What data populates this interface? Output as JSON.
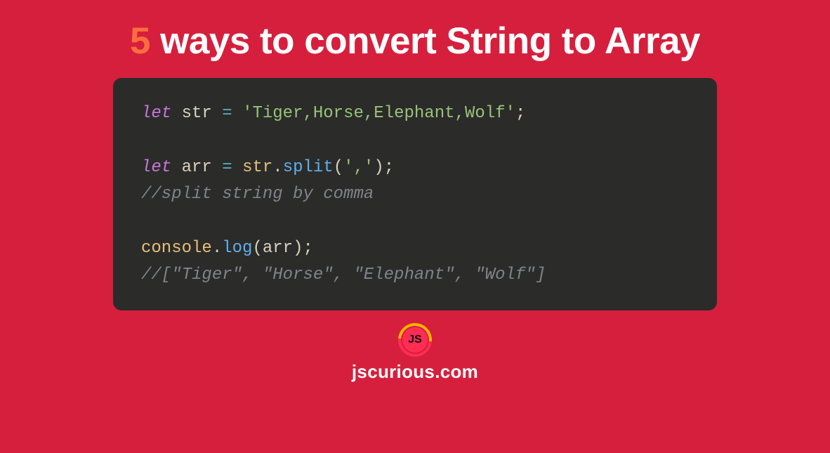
{
  "title": {
    "accent": "5",
    "rest": " ways to convert String to Array"
  },
  "code": {
    "line1": {
      "keyword": "let",
      "var": "str",
      "op": "=",
      "string": "'Tiger,Horse,Elephant,Wolf'",
      "semicolon": ";"
    },
    "line2": {
      "keyword": "let",
      "var": "arr",
      "op": "=",
      "obj": "str",
      "dot": ".",
      "method": "split",
      "open": "(",
      "arg": "','",
      "close": ")",
      "semicolon": ";"
    },
    "line3": "//split string by comma",
    "line4": {
      "obj": "console",
      "dot": ".",
      "method": "log",
      "open": "(",
      "arg": "arr",
      "close": ")",
      "semicolon": ";"
    },
    "line5": "//[\"Tiger\", \"Horse\", \"Elephant\", \"Wolf\"]"
  },
  "footer": {
    "logo_text": "JS",
    "site": "jscurious.com"
  }
}
